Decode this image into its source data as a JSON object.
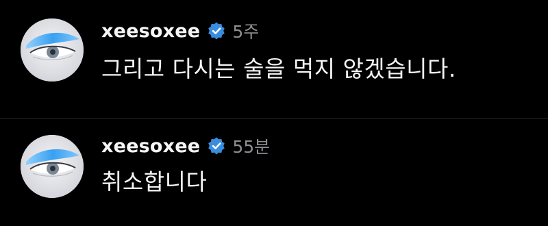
{
  "comments": [
    {
      "username": "xeesoxee",
      "verified": true,
      "time": "5주",
      "text": "그리고 다시는 술을 먹지 않겠습니다."
    },
    {
      "username": "xeesoxee",
      "verified": true,
      "time": "55분",
      "text": "취소합니다"
    }
  ],
  "icons": {
    "verified": "verified-badge-icon",
    "avatar": "profile-avatar"
  },
  "colors": {
    "background": "#000000",
    "text": "#f5f5f5",
    "timestamp": "#8e8e93",
    "verified_badge": "#3a8dde"
  }
}
